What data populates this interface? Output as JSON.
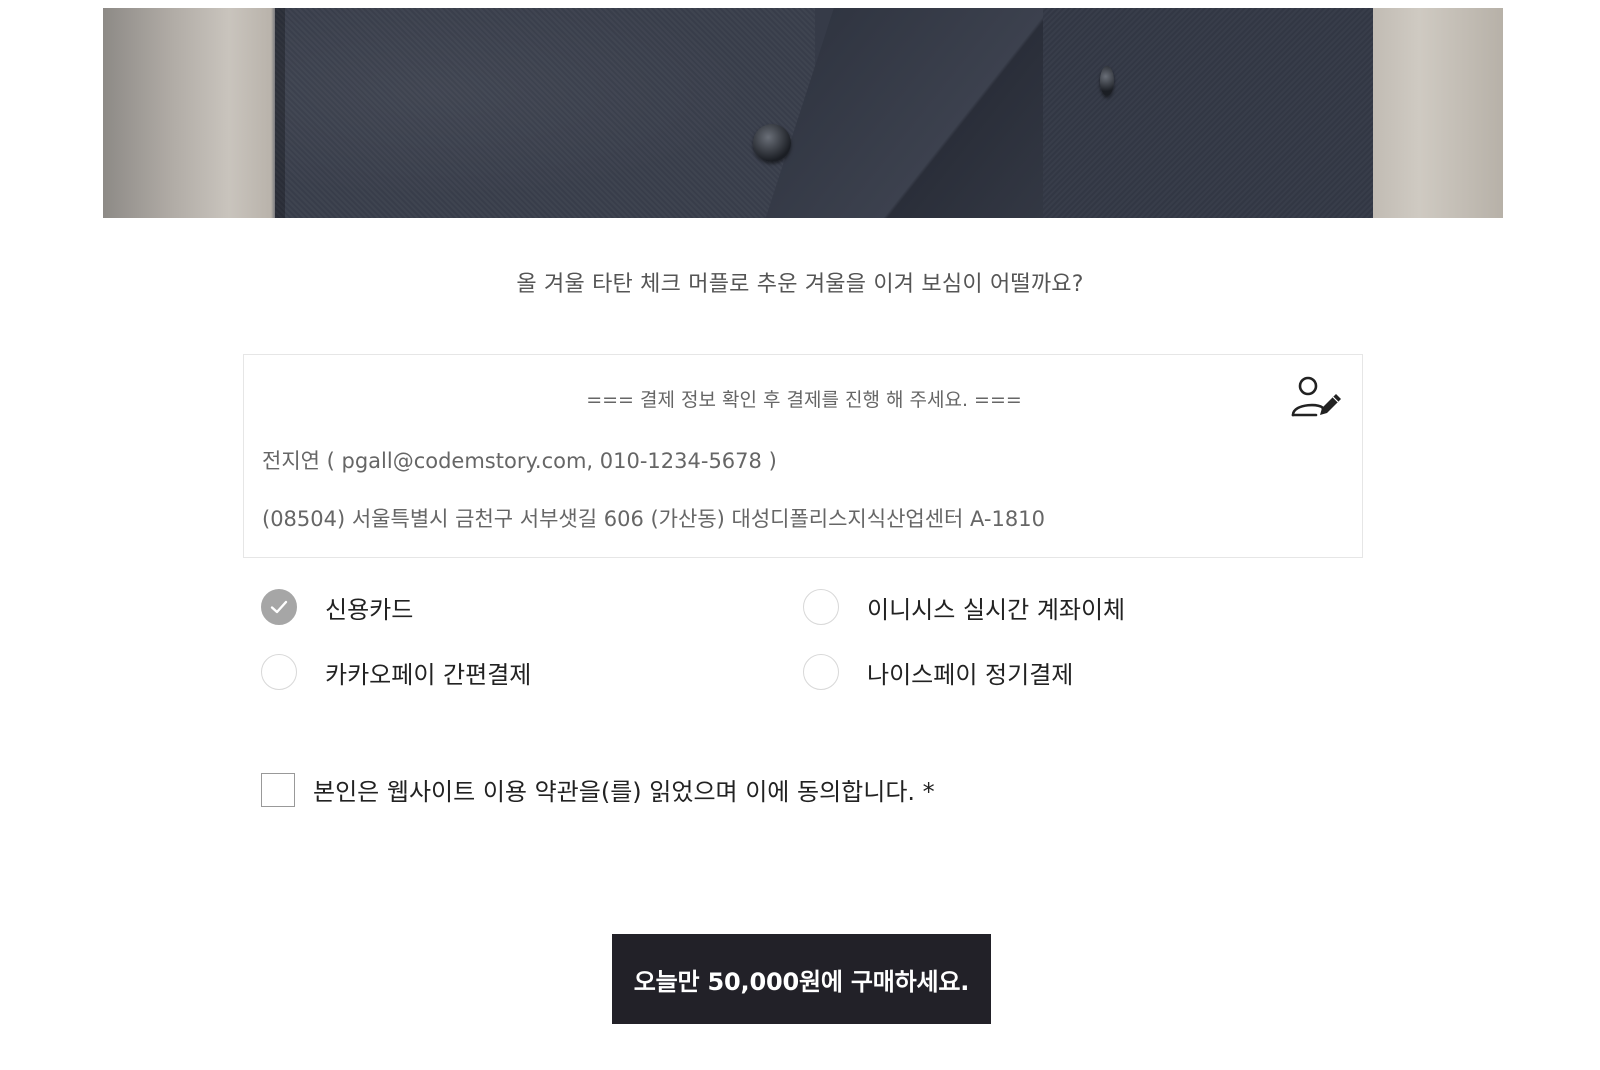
{
  "hero": {
    "alt": "wool jacket product photo"
  },
  "tagline": "올 겨울 타탄 체크 머플로 추운 겨울을 이겨 보심이 어떨까요?",
  "payment_info": {
    "title": "=== 결제 정보 확인 후 결제를 진행 해 주세요. ===",
    "contact": "전지연 ( pgall@codemstory.com, 010-1234-5678 )",
    "address": "(08504) 서울특별시 금천구 서부샛길 606 (가산동) 대성디폴리스지식산업센터 A-1810",
    "edit_icon": "user-edit-icon"
  },
  "payment_methods": [
    {
      "label": "신용카드",
      "selected": true
    },
    {
      "label": "이니시스 실시간 계좌이체",
      "selected": false
    },
    {
      "label": "카카오페이 간편결제",
      "selected": false
    },
    {
      "label": "나이스페이 정기결제",
      "selected": false
    }
  ],
  "terms": {
    "label": "본인은 웹사이트 이용 약관을(를) 읽었으며 이에 동의합니다. *",
    "checked": false
  },
  "buy_button": {
    "label": "오늘만 50,000원에 구매하세요."
  },
  "colors": {
    "button_bg": "#222128",
    "radio_selected": "#a6a6a6",
    "border": "#e6e6e6"
  }
}
